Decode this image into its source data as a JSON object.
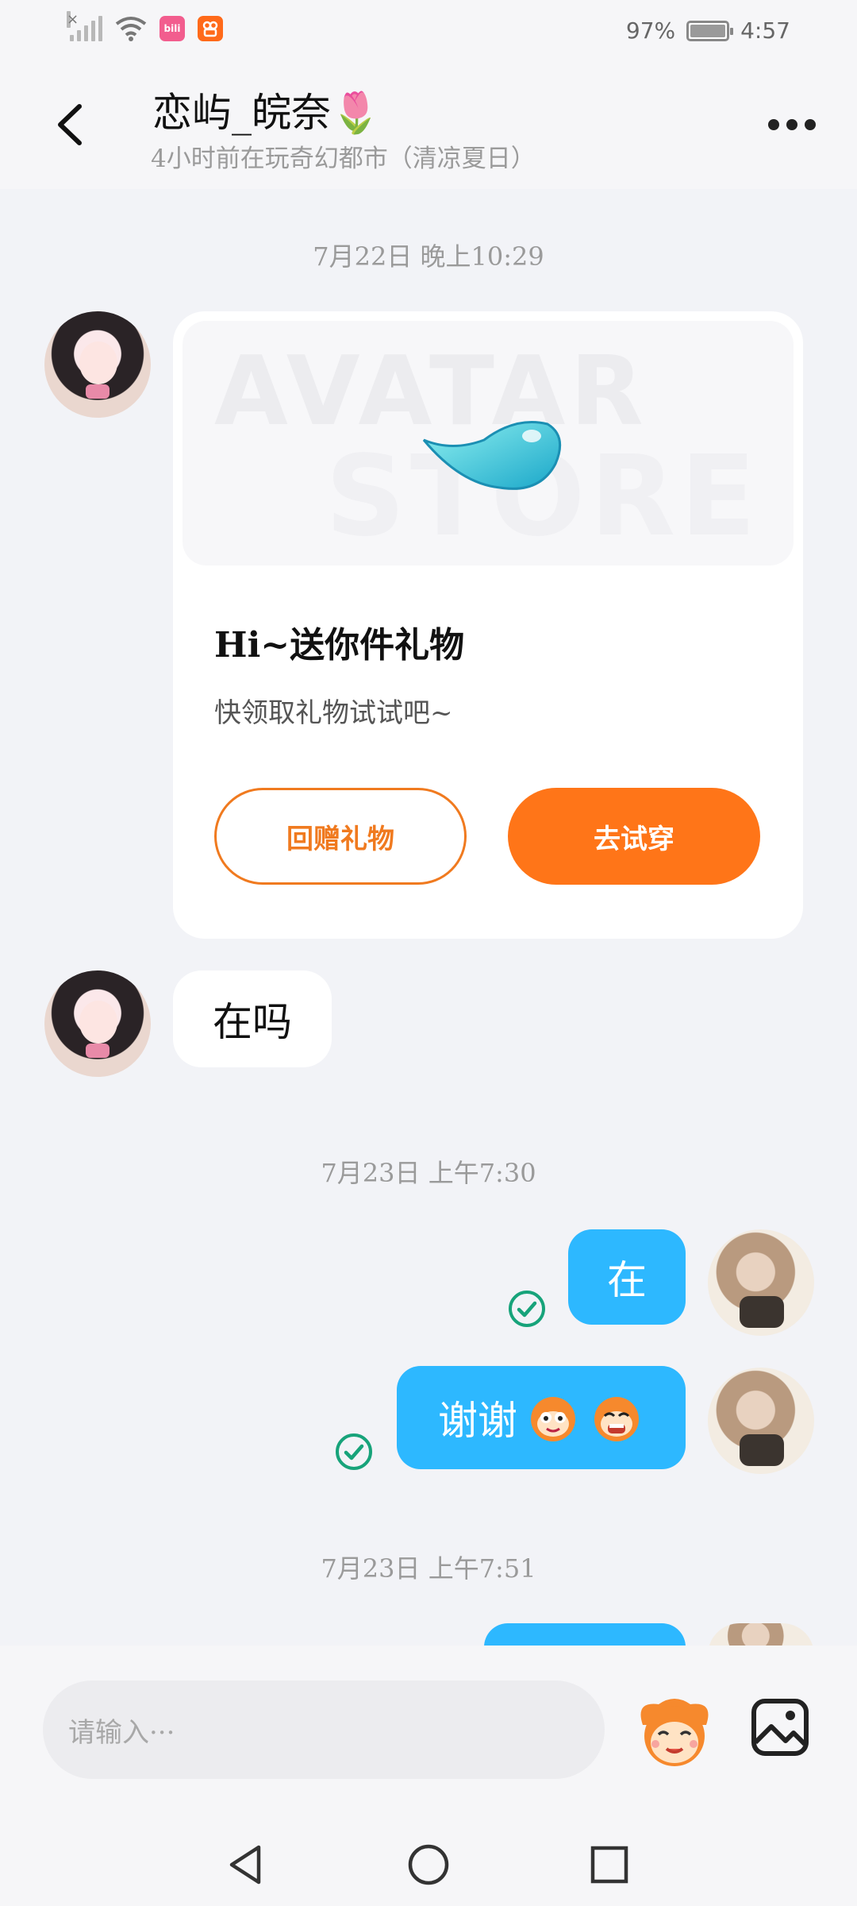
{
  "status_bar": {
    "battery": "97%",
    "time": "4:57",
    "app_icon_1_text": "bili",
    "signal_icon": "signal-no-service-icon",
    "wifi_icon": "wifi-icon"
  },
  "header": {
    "contact_name": "恋屿_皖奈🌷",
    "status": "4小时前在玩奇幻都市（清凉夏日）"
  },
  "messages": {
    "ts1": "7月22日  晚上10:29",
    "gift_card": {
      "banner_watermark_1": "AVATAR",
      "banner_watermark_2": "STORE",
      "title": "Hi~送你件礼物",
      "subtitle": "快领取礼物试试吧~",
      "return_gift_label": "回赠礼物",
      "try_on_label": "去试穿"
    },
    "msg_zaima": "在吗",
    "ts2": "7月23日  上午7:30",
    "msg_zai": "在",
    "msg_xiexie": "谢谢",
    "ts3": "7月23日  上午7:51"
  },
  "input": {
    "placeholder": "请输入···"
  },
  "colors": {
    "accent_orange": "#ff7518",
    "bubble_blue": "#2db8ff",
    "read_check": "#17a37a",
    "background": "#f2f3f7"
  }
}
